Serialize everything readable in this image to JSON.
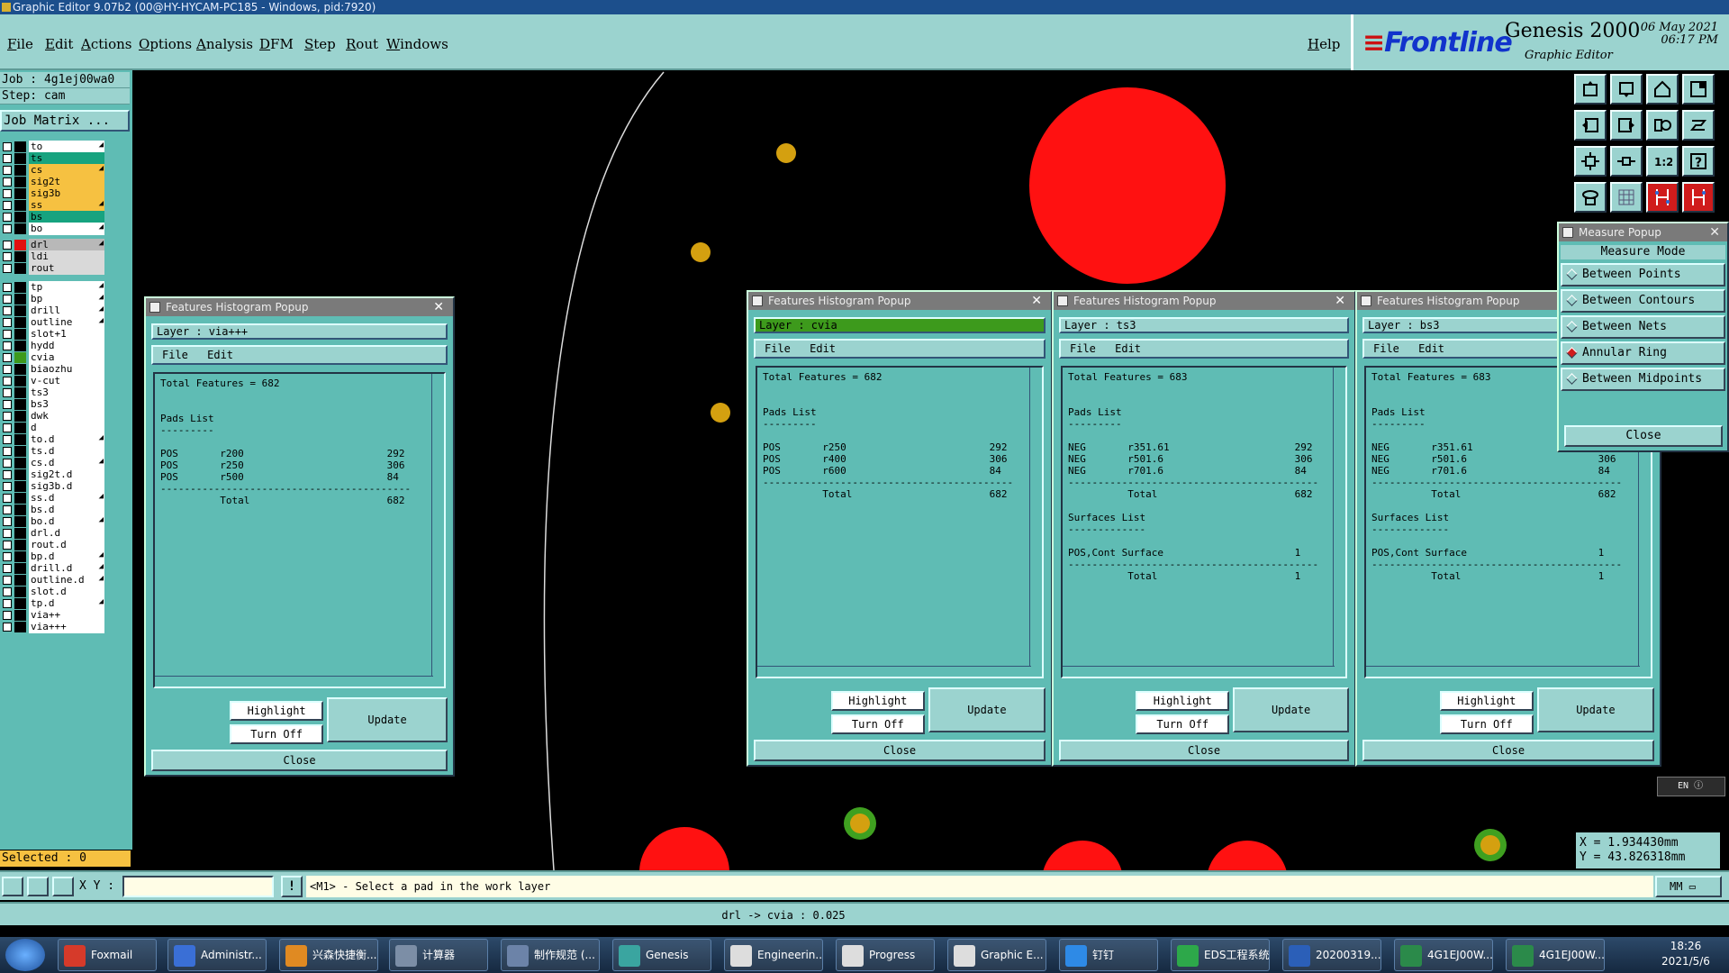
{
  "window_title": "Graphic Editor 9.07b2 (00@HY-HYCAM-PC185 - Windows, pid:7920)",
  "menu": [
    "File",
    "Edit",
    "Actions",
    "Options",
    "Analysis",
    "DFM",
    "Step",
    "Rout",
    "Windows"
  ],
  "help": "Help",
  "brand": {
    "logo_main": "Frontline",
    "product": "Genesis 2000",
    "subtitle": "Graphic Editor",
    "date": "06 May 2021",
    "time": "06:17 PM"
  },
  "job_label": "Job : 4g1ej00wa0",
  "step_label": "Step: cam",
  "job_matrix": "Job Matrix ...",
  "layers": [
    {
      "name": "to",
      "color": "#ffffff",
      "arrow": true
    },
    {
      "name": "ts",
      "color": "#17a37f",
      "arrow": false
    },
    {
      "name": "cs",
      "color": "#f6c141",
      "arrow": true
    },
    {
      "name": "sig2t",
      "color": "#f6c141",
      "arrow": false
    },
    {
      "name": "sig3b",
      "color": "#f6c141",
      "arrow": false
    },
    {
      "name": "ss",
      "color": "#f6c141",
      "arrow": true
    },
    {
      "name": "bs",
      "color": "#17a37f",
      "arrow": false
    },
    {
      "name": "bo",
      "color": "#ffffff",
      "arrow": true
    },
    {
      "name": "drl",
      "color": "#b8b8b8",
      "arrow": true,
      "swatch": "#e01010"
    },
    {
      "name": "ldi",
      "color": "#d9d9d9",
      "arrow": false
    },
    {
      "name": "rout",
      "color": "#d9d9d9",
      "arrow": false
    },
    {
      "name": "tp",
      "color": "#ffffff",
      "arrow": true
    },
    {
      "name": "bp",
      "color": "#ffffff",
      "arrow": true
    },
    {
      "name": "drill",
      "color": "#ffffff",
      "arrow": true
    },
    {
      "name": "outline",
      "color": "#ffffff",
      "arrow": true
    },
    {
      "name": "slot+1",
      "color": "#ffffff",
      "arrow": false
    },
    {
      "name": "hydd",
      "color": "#ffffff",
      "arrow": false
    },
    {
      "name": "cvia",
      "color": "#ffffff",
      "arrow": false,
      "swatch": "#3d9a1c"
    },
    {
      "name": "biaozhu",
      "color": "#ffffff",
      "arrow": false
    },
    {
      "name": "v-cut",
      "color": "#ffffff",
      "arrow": false
    },
    {
      "name": "ts3",
      "color": "#ffffff",
      "arrow": false
    },
    {
      "name": "bs3",
      "color": "#ffffff",
      "arrow": false
    },
    {
      "name": "dwk",
      "color": "#ffffff",
      "arrow": false
    },
    {
      "name": "d",
      "color": "#ffffff",
      "arrow": false
    },
    {
      "name": "to.d",
      "color": "#ffffff",
      "arrow": true
    },
    {
      "name": "ts.d",
      "color": "#ffffff",
      "arrow": false
    },
    {
      "name": "cs.d",
      "color": "#ffffff",
      "arrow": true
    },
    {
      "name": "sig2t.d",
      "color": "#ffffff",
      "arrow": false
    },
    {
      "name": "sig3b.d",
      "color": "#ffffff",
      "arrow": false
    },
    {
      "name": "ss.d",
      "color": "#ffffff",
      "arrow": true
    },
    {
      "name": "bs.d",
      "color": "#ffffff",
      "arrow": false
    },
    {
      "name": "bo.d",
      "color": "#ffffff",
      "arrow": true
    },
    {
      "name": "drl.d",
      "color": "#ffffff",
      "arrow": false
    },
    {
      "name": "rout.d",
      "color": "#ffffff",
      "arrow": false
    },
    {
      "name": "bp.d",
      "color": "#ffffff",
      "arrow": true
    },
    {
      "name": "drill.d",
      "color": "#ffffff",
      "arrow": true
    },
    {
      "name": "outline.d",
      "color": "#ffffff",
      "arrow": true
    },
    {
      "name": "slot.d",
      "color": "#ffffff",
      "arrow": false
    },
    {
      "name": "tp.d",
      "color": "#ffffff",
      "arrow": true
    },
    {
      "name": "via++",
      "color": "#ffffff",
      "arrow": false
    },
    {
      "name": "via+++",
      "color": "#ffffff",
      "arrow": false
    }
  ],
  "selected": "Selected : 0",
  "popups": [
    {
      "title": "Features Histogram Popup",
      "layer": "Layer :  via+++",
      "menu": "File Edit",
      "text": "Total Features = 682\n\n\nPads List\n---------\n\nPOS       r200                        292\nPOS       r250                        306\nPOS       r500                        84\n------------------------------------------\n          Total                       682",
      "highlight": "Highlight",
      "turnoff": "Turn Off",
      "update": "Update",
      "close": "Close"
    },
    {
      "title": "Features Histogram Popup",
      "layer": "Layer :  cvia",
      "menu": "File Edit",
      "text": "Total Features = 682\n\n\nPads List\n---------\n\nPOS       r250                        292\nPOS       r400                        306\nPOS       r600                        84\n------------------------------------------\n          Total                       682",
      "highlight": "Highlight",
      "turnoff": "Turn Off",
      "update": "Update",
      "close": "Close"
    },
    {
      "title": "Features Histogram Popup",
      "layer": "Layer :  ts3",
      "menu": "File Edit",
      "text": "Total Features = 683\n\n\nPads List\n---------\n\nNEG       r351.61                     292\nNEG       r501.6                      306\nNEG       r701.6                      84\n------------------------------------------\n          Total                       682\n\nSurfaces List\n-------------\n\nPOS,Cont Surface                      1\n------------------------------------------\n          Total                       1",
      "highlight": "Highlight",
      "turnoff": "Turn Off",
      "update": "Update",
      "close": "Close"
    },
    {
      "title": "Features Histogram Popup",
      "layer": "Layer :  bs3",
      "menu": "File Edit",
      "text": "Total Features = 683\n\n\nPads List\n---------\n\nNEG       r351.61                     292\nNEG       r501.6                      306\nNEG       r701.6                      84\n------------------------------------------\n          Total                       682\n\nSurfaces List\n-------------\n\nPOS,Cont Surface                      1\n------------------------------------------\n          Total                       1",
      "highlight": "Highlight",
      "turnoff": "Turn Off",
      "update": "Update",
      "close": "Close"
    }
  ],
  "measure": {
    "title": "Measure Popup",
    "mode": "Measure Mode",
    "options": [
      "Between Points",
      "Between Contours",
      "Between Nets",
      "Annular Ring",
      "Between Midpoints"
    ],
    "selected_option": "Annular Ring",
    "close": "Close"
  },
  "coords": {
    "x": "X = 1.934430mm",
    "y": "Y = 43.826318mm"
  },
  "lang": "EN",
  "xy_label": "X Y :",
  "prompt": "<M1> - Select a pad in the work layer",
  "units": "MM",
  "status": "drl -> cvia : 0.025",
  "taskbar": [
    {
      "label": "Foxmail",
      "color": "#d63a2a"
    },
    {
      "label": "Administr...",
      "color": "#3a6fd6"
    },
    {
      "label": "兴森快捷衡...",
      "color": "#e08a22"
    },
    {
      "label": "计算器",
      "color": "#7c8ea6"
    },
    {
      "label": "制作规范 (...",
      "color": "#6c83a8"
    },
    {
      "label": "Genesis",
      "color": "#3aa5a0"
    },
    {
      "label": "Engineerin...",
      "color": "#dddddd"
    },
    {
      "label": "Progress",
      "color": "#dddddd"
    },
    {
      "label": "Graphic E...",
      "color": "#dddddd"
    },
    {
      "label": "钉钉",
      "color": "#2e8ae6"
    },
    {
      "label": "EDS工程系统",
      "color": "#2da84a"
    },
    {
      "label": "20200319...",
      "color": "#2b5fb8"
    },
    {
      "label": "4G1EJ00W...",
      "color": "#2b8a4a"
    },
    {
      "label": "4G1EJ00W...",
      "color": "#2b8a4a"
    }
  ],
  "clock": {
    "time": "18:26",
    "date": "2021/5/6"
  }
}
